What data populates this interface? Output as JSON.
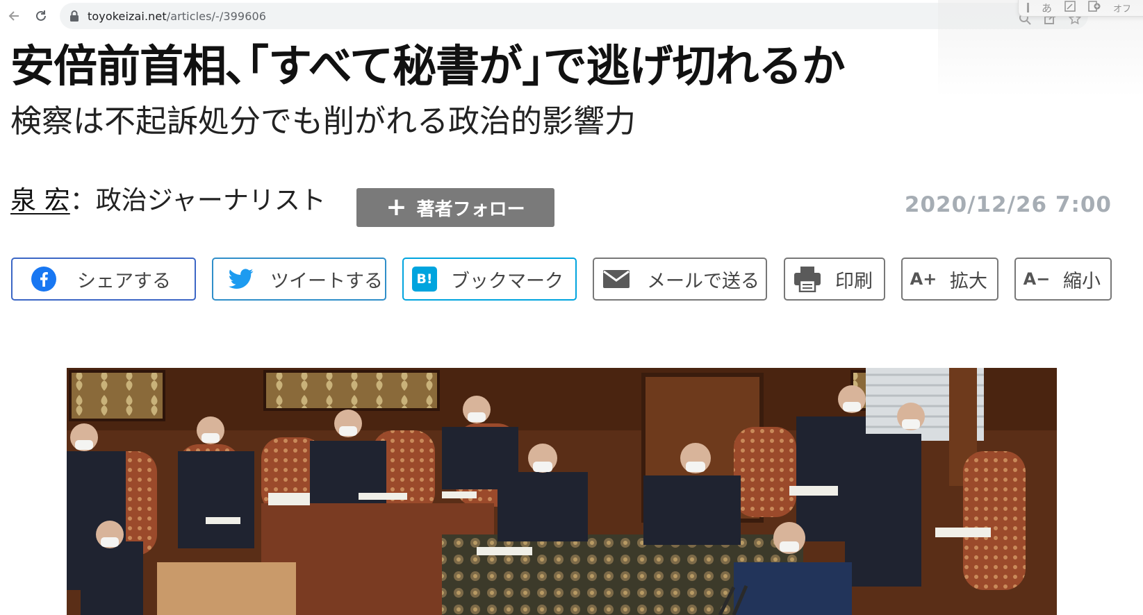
{
  "browser": {
    "url_host": "toyokeizai.net",
    "url_path": "/articles/-/399606",
    "ext_popup_text": "オフ",
    "icons": [
      "back-icon",
      "reload-icon",
      "lock-icon",
      "zoom-icon",
      "share-icon",
      "star-icon"
    ]
  },
  "article": {
    "title": "安倍前首相､｢すべて秘書が｣で逃げ切れるか",
    "subtitle": "検察は不起訴処分でも削がれる政治的影響力",
    "author_name": "泉 宏",
    "author_role": "：政治ジャーナリスト",
    "follow_label": "著者フォロー",
    "date": "2020/12/26 7:00"
  },
  "share": {
    "facebook": "シェアする",
    "twitter": "ツイートする",
    "hatena": "ブックマーク",
    "hatena_icon_text": "B!",
    "mail": "メールで送る",
    "print": "印刷",
    "zoom_in": "拡大",
    "zoom_in_icon_text": "A+",
    "zoom_out": "縮小",
    "zoom_out_icon_text": "A−"
  },
  "colors": {
    "facebook": "#1877f2",
    "twitter": "#1d9bf0",
    "hatena": "#00a4de",
    "follow_button": "#7a7a7a",
    "date": "#a6adb4"
  }
}
